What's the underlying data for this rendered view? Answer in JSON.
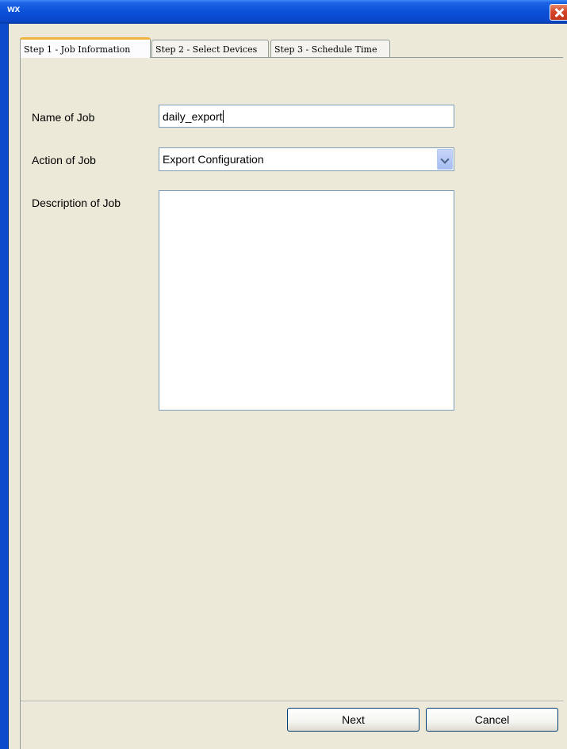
{
  "window": {
    "title_icon_text": "WX"
  },
  "tabs": [
    {
      "label": "Step 1 - Job Information",
      "active": true
    },
    {
      "label": "Step 2 - Select Devices",
      "active": false
    },
    {
      "label": "Step 3 - Schedule Time",
      "active": false
    }
  ],
  "form": {
    "name_label": "Name of Job",
    "name_value": "daily_export",
    "action_label": "Action of Job",
    "action_value": "Export Configuration",
    "description_label": "Description of Job",
    "description_value": ""
  },
  "buttons": {
    "next_label": "Next",
    "cancel_label": "Cancel"
  },
  "colors": {
    "titlebar": "#0a50d8",
    "panel_background": "#ece9d8",
    "active_tab_highlight": "#f1b33f",
    "close_button": "#c3361b"
  }
}
